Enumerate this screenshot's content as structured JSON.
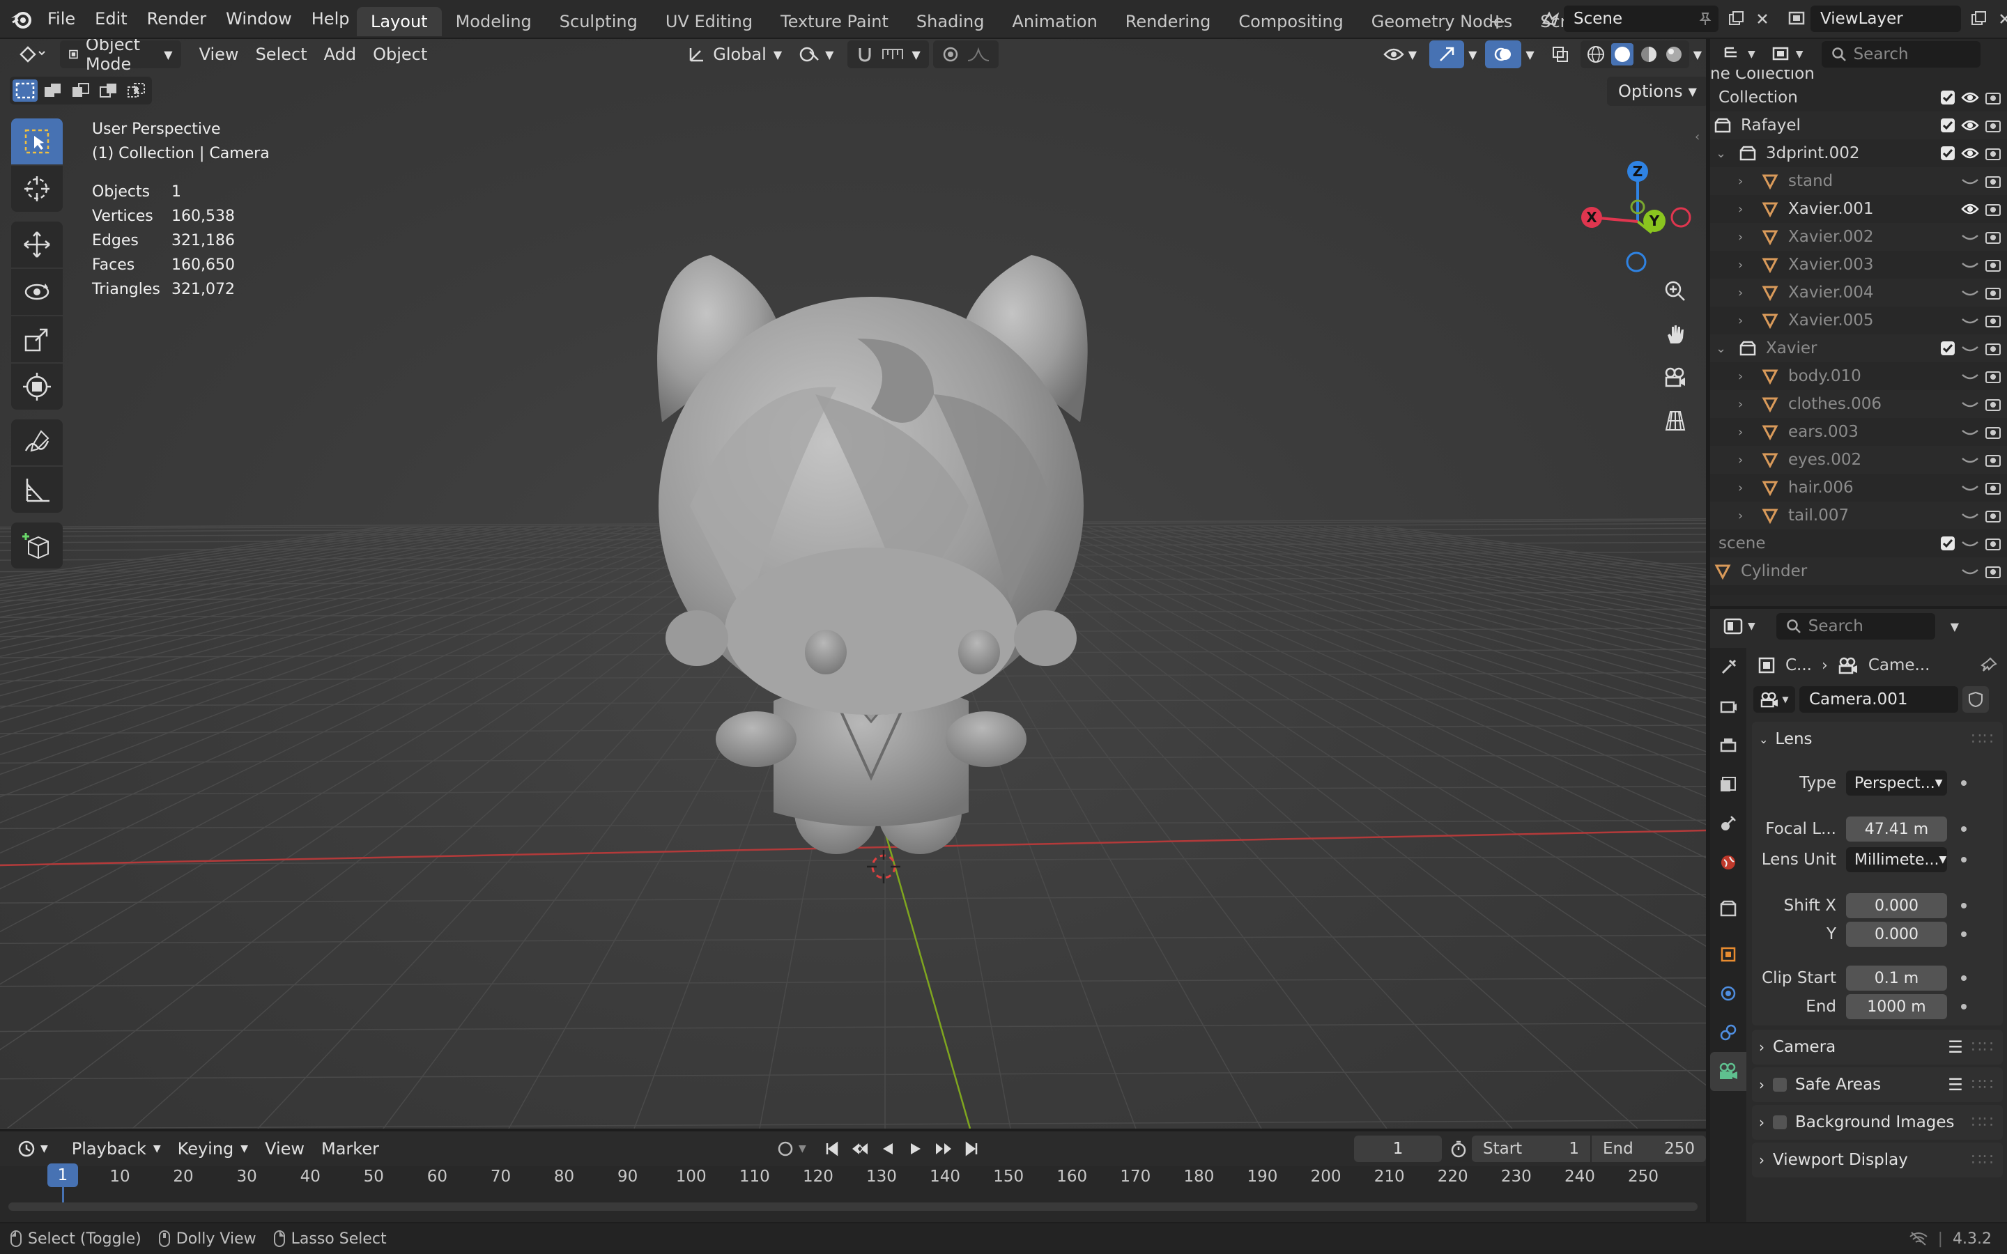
{
  "topbar": {
    "menus": [
      "File",
      "Edit",
      "Render",
      "Window",
      "Help"
    ],
    "workspaces": [
      "Layout",
      "Modeling",
      "Sculpting",
      "UV Editing",
      "Texture Paint",
      "Shading",
      "Animation",
      "Rendering",
      "Compositing",
      "Geometry Nodes",
      "Scripting"
    ],
    "active_workspace": "Layout",
    "scene_name": "Scene",
    "view_layer": "ViewLayer"
  },
  "viewport_header": {
    "mode": "Object Mode",
    "menus": [
      "View",
      "Select",
      "Add",
      "Object"
    ],
    "orientation": "Global",
    "options_label": "Options"
  },
  "viewport_info": {
    "view_name": "User Perspective",
    "context": "(1) Collection | Camera",
    "stats": [
      {
        "label": "Objects",
        "value": "1"
      },
      {
        "label": "Vertices",
        "value": "160,538"
      },
      {
        "label": "Edges",
        "value": "321,186"
      },
      {
        "label": "Faces",
        "value": "160,650"
      },
      {
        "label": "Triangles",
        "value": "321,072"
      }
    ]
  },
  "gizmo": {
    "z": "Z",
    "y": "Y",
    "x": "X"
  },
  "outliner": {
    "search_placeholder": "Search",
    "title_partial": "ne Collection",
    "rows": [
      {
        "label": "Collection",
        "indent": 0,
        "kind": "none",
        "check": true,
        "eye": true,
        "dim": false
      },
      {
        "label": "Rafayel",
        "indent": 0,
        "kind": "collection",
        "check": true,
        "eye": true,
        "dim": false
      },
      {
        "label": "3dprint.002",
        "indent": 1,
        "kind": "collection",
        "check": true,
        "eye": true,
        "dim": false
      },
      {
        "label": "stand",
        "indent": 2,
        "kind": "mesh",
        "check": false,
        "eye": false,
        "dim": true
      },
      {
        "label": "Xavier.001",
        "indent": 2,
        "kind": "mesh",
        "check": false,
        "eye": true,
        "dim": false
      },
      {
        "label": "Xavier.002",
        "indent": 2,
        "kind": "mesh",
        "check": false,
        "eye": false,
        "dim": true
      },
      {
        "label": "Xavier.003",
        "indent": 2,
        "kind": "mesh",
        "check": false,
        "eye": false,
        "dim": true
      },
      {
        "label": "Xavier.004",
        "indent": 2,
        "kind": "mesh",
        "check": false,
        "eye": false,
        "dim": true
      },
      {
        "label": "Xavier.005",
        "indent": 2,
        "kind": "mesh",
        "check": false,
        "eye": false,
        "dim": true
      },
      {
        "label": "Xavier",
        "indent": 1,
        "kind": "collection",
        "check": true,
        "eye": false,
        "dim": true
      },
      {
        "label": "body.010",
        "indent": 2,
        "kind": "mesh",
        "check": false,
        "eye": false,
        "dim": true
      },
      {
        "label": "clothes.006",
        "indent": 2,
        "kind": "mesh",
        "check": false,
        "eye": false,
        "dim": true
      },
      {
        "label": "ears.003",
        "indent": 2,
        "kind": "mesh",
        "check": false,
        "eye": false,
        "dim": true
      },
      {
        "label": "eyes.002",
        "indent": 2,
        "kind": "mesh",
        "check": false,
        "eye": false,
        "dim": true
      },
      {
        "label": "hair.006",
        "indent": 2,
        "kind": "mesh",
        "check": false,
        "eye": false,
        "dim": true
      },
      {
        "label": "tail.007",
        "indent": 2,
        "kind": "mesh",
        "check": false,
        "eye": false,
        "dim": true
      },
      {
        "label": "scene",
        "indent": 0,
        "kind": "none",
        "check": true,
        "eye": false,
        "dim": true
      },
      {
        "label": "Cylinder",
        "indent": 0,
        "kind": "mesh",
        "check": false,
        "eye": false,
        "dim": true
      }
    ]
  },
  "properties": {
    "search_placeholder": "Search",
    "breadcrumb": [
      "C...",
      "Came..."
    ],
    "datablock": "Camera.001",
    "lens_panel": "Lens",
    "fields": {
      "type_label": "Type",
      "type_value": "Perspect...",
      "focal_label": "Focal L...",
      "focal_value": "47.41 m",
      "unit_label": "Lens Unit",
      "unit_value": "Millimete...",
      "shiftx_label": "Shift X",
      "shiftx_value": "0.000",
      "shifty_label": "Y",
      "shifty_value": "0.000",
      "clipstart_label": "Clip Start",
      "clipstart_value": "0.1 m",
      "clipend_label": "End",
      "clipend_value": "1000 m"
    },
    "panels": [
      "Camera",
      "Safe Areas",
      "Background Images",
      "Viewport Display"
    ]
  },
  "timeline": {
    "menus": [
      "Playback",
      "Keying",
      "View",
      "Marker"
    ],
    "current_frame": "1",
    "start_label": "Start",
    "start_value": "1",
    "end_label": "End",
    "end_value": "250",
    "frames": [
      "1",
      "10",
      "20",
      "30",
      "40",
      "50",
      "60",
      "70",
      "80",
      "90",
      "100",
      "110",
      "120",
      "130",
      "140",
      "150",
      "160",
      "170",
      "180",
      "190",
      "200",
      "210",
      "220",
      "230",
      "240",
      "250"
    ]
  },
  "statusbar": {
    "hints": [
      "Select (Toggle)",
      "Dolly View",
      "Lasso Select"
    ],
    "version": "4.3.2"
  },
  "colors": {
    "accent": "#4772b3",
    "x_axis": "#e0364f",
    "y_axis": "#8ac51f",
    "z_axis": "#2f83e3",
    "mesh_icon": "#d99a5a"
  }
}
